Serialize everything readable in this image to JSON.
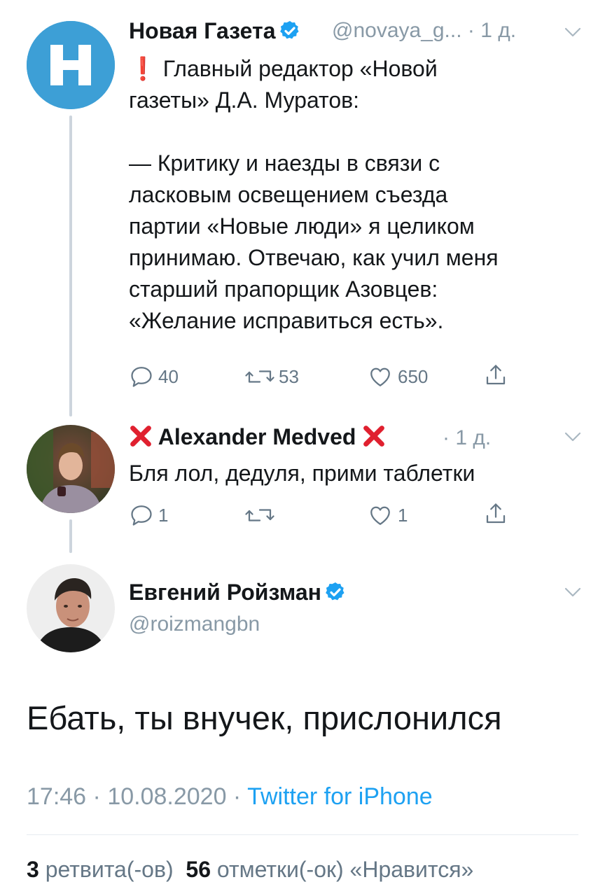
{
  "tweet1": {
    "author": "Новая Газета",
    "handle": "@novaya_g...",
    "time": "1 д.",
    "text_line1": "❗ Главный редактор «Новой",
    "text_rest": "газеты» Д.А. Муратов:\n\n— Критику и наезды в связи с\nласковым освещением съезда\nпартии «Новые люди» я целиком\nпринимаю. Отвечаю, как учил меня\nстарший прапорщик Азовцев:\n«Желание исправиться есть».",
    "replies": "40",
    "retweets": "53",
    "likes": "650"
  },
  "tweet2": {
    "author": "Alexander Medved",
    "time": "1 д.",
    "text": "Бля лол, дедуля, прими таблетки",
    "replies": "1",
    "likes": "1"
  },
  "main": {
    "author": "Евгений Ройзман",
    "handle": "@roizmangbn",
    "text": "Ебать, ты внучек, прислонился",
    "time": "17:46",
    "date": "10.08.2020",
    "source": "Twitter for iPhone",
    "retweet_count": "3",
    "retweet_label": "ретвита(-ов)",
    "like_count": "56",
    "like_label": "отметки(-ок) «Нравится»"
  },
  "icons": {
    "reply": "reply-icon",
    "retweet": "retweet-icon",
    "like": "heart-icon",
    "share": "share-icon",
    "verified": "verified-badge-icon",
    "chevron": "chevron-down-icon",
    "x": "red-x-emoji-icon"
  },
  "colors": {
    "brand": "#1da1f2",
    "muted": "#8899a6",
    "text": "#14171a",
    "red_x": "#e0202f"
  }
}
